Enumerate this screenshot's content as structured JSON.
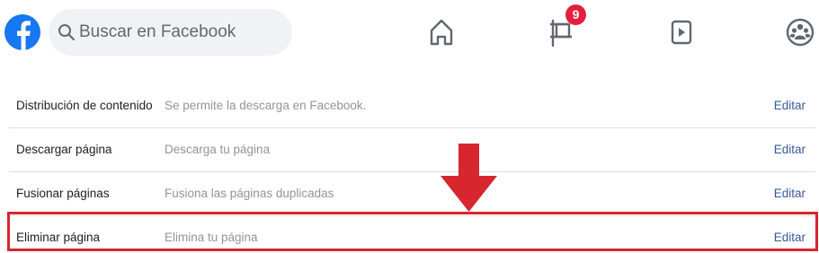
{
  "header": {
    "search_placeholder": "Buscar en Facebook",
    "notification_count": "9"
  },
  "settings_rows": [
    {
      "label": "Distribución de contenido",
      "description": "Se permite la descarga en Facebook.",
      "action": "Editar"
    },
    {
      "label": "Descargar página",
      "description": "Descarga tu página",
      "action": "Editar"
    },
    {
      "label": "Fusionar páginas",
      "description": "Fusiona las páginas duplicadas",
      "action": "Editar"
    },
    {
      "label": "Eliminar página",
      "description": "Elimina tu página",
      "action": "Editar"
    }
  ],
  "colors": {
    "facebook_blue": "#1877f2",
    "link_blue": "#385898",
    "highlight_red": "#d7262e",
    "badge_red": "#e41e3f"
  }
}
